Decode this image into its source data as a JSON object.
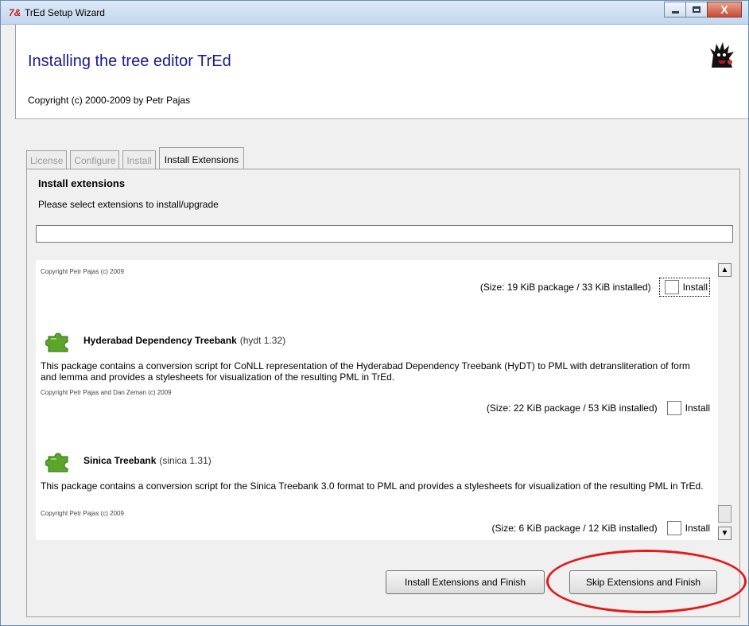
{
  "window": {
    "title": "TrEd Setup Wizard",
    "icon": "tk-feather-icon",
    "close_glyph": "X"
  },
  "header": {
    "heading": "Installing the tree editor TrEd",
    "copyright": "Copyright (c) 2000-2009 by Petr Pajas"
  },
  "tabs": [
    {
      "label": "License",
      "active": false
    },
    {
      "label": "Configure",
      "active": false
    },
    {
      "label": "Install",
      "active": false
    },
    {
      "label": "Install Extensions",
      "active": true
    }
  ],
  "panel": {
    "heading": "Install extensions",
    "subheading": "Please select extensions to install/upgrade",
    "search_value": ""
  },
  "extensions": [
    {
      "name": "",
      "version": "",
      "description": "",
      "copyright": "Copyright Petr Pajas (c) 2009",
      "size": "(Size: 19 KiB package / 33 KiB installed)",
      "install_label": "Install",
      "checked": false
    },
    {
      "name": "Hyderabad Dependency Treebank",
      "version": "(hydt 1.32)",
      "description": "This package contains a conversion script for CoNLL representation of the Hyderabad Dependency Treebank (HyDT) to PML with detransliteration of form and lemma and provides a stylesheets for visualization of the resulting PML in TrEd.",
      "copyright": "Copyright Petr Pajas and Dan Zeman (c) 2009",
      "size": "(Size: 22 KiB package / 53 KiB installed)",
      "install_label": "Install",
      "checked": false
    },
    {
      "name": "Sinica Treebank",
      "version": "(sinica 1.31)",
      "description": "This package contains a conversion script for the Sinica Treebank 3.0 format to PML and provides a stylesheets for visualization of the resulting PML in TrEd.",
      "copyright": "Copyright Petr Pajas (c) 2009",
      "size": "(Size: 6 KiB package / 12 KiB installed)",
      "install_label": "Install",
      "checked": false
    }
  ],
  "buttons": {
    "install_finish": "Install Extensions and Finish",
    "skip_finish": "Skip Extensions and Finish"
  },
  "annotation": {
    "highlight_color": "#e21b1b"
  }
}
